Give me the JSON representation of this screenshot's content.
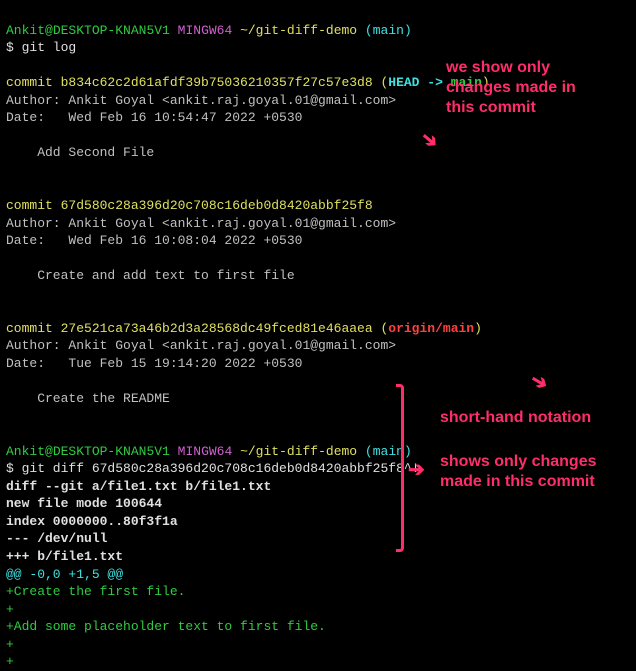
{
  "prompt1": {
    "user": "Ankit",
    "at": "@",
    "host": "DESKTOP-KNAN5V1",
    "space": " ",
    "env": "MINGW64",
    "path": " ~/git-diff-demo",
    "branch_open": " (",
    "branch": "main",
    "branch_close": ")"
  },
  "cmd1": "$ git log",
  "commit1": {
    "label": "commit ",
    "hash": "b834c62c2d61afdf39b75036210357f27c57e3d8",
    "open": " (",
    "head": "HEAD -> ",
    "ref": "main",
    "close": ")"
  },
  "author1": "Author: Ankit Goyal <ankit.raj.goyal.01@gmail.com>",
  "date1": "Date:   Wed Feb 16 10:54:47 2022 +0530",
  "msg1": "    Add Second File",
  "commit2": {
    "label": "commit ",
    "hash": "67d580c28a396d20c708c16deb0d8420abbf25f8"
  },
  "author2": "Author: Ankit Goyal <ankit.raj.goyal.01@gmail.com>",
  "date2": "Date:   Wed Feb 16 10:08:04 2022 +0530",
  "msg2": "    Create and add text to first file",
  "commit3": {
    "label": "commit ",
    "hash": "27e521ca73a46b2d3a28568dc49fced81e46aaea",
    "open": " (",
    "ref": "origin/main",
    "close": ")"
  },
  "author3": "Author: Ankit Goyal <ankit.raj.goyal.01@gmail.com>",
  "date3": "Date:   Tue Feb 15 19:14:20 2022 +0530",
  "msg3": "    Create the README",
  "prompt2": {
    "user": "Ankit",
    "at": "@",
    "host": "DESKTOP-KNAN5V1",
    "space": " ",
    "env": "MINGW64",
    "path": " ~/git-diff-demo",
    "branch_open": " (",
    "branch": "main",
    "branch_close": ")"
  },
  "cmd2": "$ git diff 67d580c28a396d20c708c16deb0d8420abbf25f8^!",
  "diff": {
    "header": "diff --git a/file1.txt b/file1.txt",
    "newfile": "new file mode 100644",
    "index": "index 0000000..80f3f1a",
    "minus": "--- /dev/null",
    "plus": "+++ b/file1.txt",
    "hunk": "@@ -0,0 +1,5 @@",
    "l1": "+Create the first file.",
    "l2": "+",
    "l3": "+Add some placeholder text to first file.",
    "l4": "+",
    "l5": "+"
  },
  "annotations": {
    "a1_l1": "we show only",
    "a1_l2": "changes made in",
    "a1_l3": "this commit",
    "a2": "short-hand notation",
    "a3_l1": "shows only changes",
    "a3_l2": "made in this commit"
  }
}
